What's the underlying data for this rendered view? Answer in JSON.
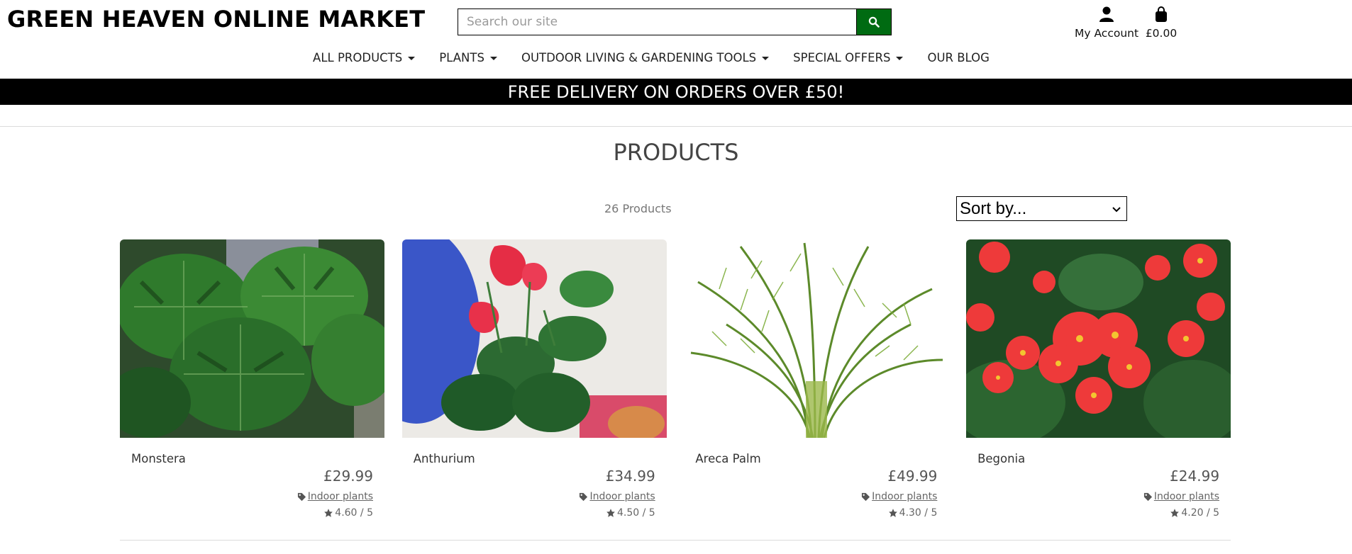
{
  "brand": "GREEN HEAVEN ONLINE MARKET",
  "search": {
    "placeholder": "Search our site",
    "value": ""
  },
  "account_label": "My Account",
  "cart_total": "£0.00",
  "nav": [
    {
      "label": "ALL PRODUCTS"
    },
    {
      "label": "PLANTS"
    },
    {
      "label": "OUTDOOR LIVING & GARDENING TOOLS"
    },
    {
      "label": "SPECIAL OFFERS"
    },
    {
      "label": "OUR BLOG"
    }
  ],
  "banner": "FREE DELIVERY ON ORDERS OVER £50!",
  "page_title": "PRODUCTS",
  "product_count": "26 Products",
  "sort_label": "Sort by...",
  "products": [
    {
      "name": "Monstera",
      "price": "£29.99",
      "category": "Indoor plants",
      "rating": "4.60 / 5"
    },
    {
      "name": "Anthurium",
      "price": "£34.99",
      "category": "Indoor plants",
      "rating": "4.50 / 5"
    },
    {
      "name": "Areca Palm",
      "price": "£49.99",
      "category": "Indoor plants",
      "rating": "4.30 / 5"
    },
    {
      "name": "Begonia",
      "price": "£24.99",
      "category": "Indoor plants",
      "rating": "4.20 / 5"
    }
  ],
  "colors": {
    "search_button": "#006b12",
    "banner_bg": "#000000",
    "banner_text": "#ffffff"
  },
  "icons": [
    "search-icon",
    "user-icon",
    "shopping-bag-icon",
    "tag-icon",
    "star-icon",
    "caret-down-icon"
  ]
}
